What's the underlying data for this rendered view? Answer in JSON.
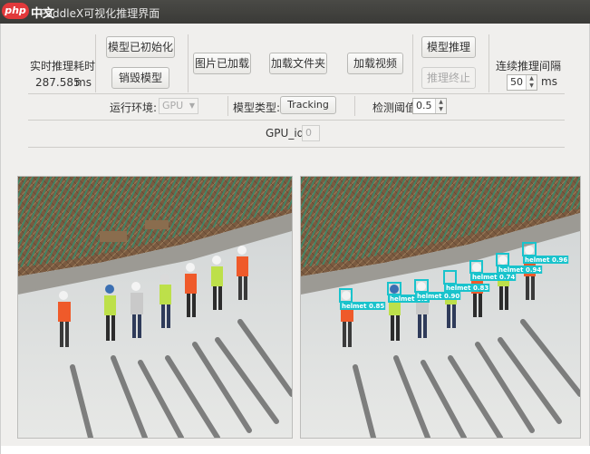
{
  "window": {
    "title": "PaddleX可视化推理界面",
    "watermark_php": "php",
    "watermark_cn": "中文网"
  },
  "controls": {
    "infer_time_label": "实时推理耗时",
    "infer_time_value": "287.585",
    "infer_time_unit": "ms",
    "init_model_btn": "模型已初始化",
    "destroy_model_btn": "销毁模型",
    "image_loaded_btn": "图片已加载",
    "load_folder_btn": "加载文件夹",
    "load_video_btn": "加载视频",
    "model_infer_btn": "模型推理",
    "stop_infer_btn": "推理终止",
    "interval_label": "连续推理间隔",
    "interval_value": "50",
    "interval_unit": "ms"
  },
  "settings": {
    "env_label": "运行环境:",
    "env_value": "GPU",
    "model_type_label": "模型类型:",
    "model_type_value": "Tracking",
    "threshold_label": "检测阈值",
    "threshold_value": "0.5",
    "gpu_id_label": "GPU_id",
    "gpu_id_value": "0"
  },
  "detections": {
    "class_label": "helmet",
    "box_color": "#19c3cc",
    "items": [
      {
        "score": "0.85"
      },
      {
        "score": "0.9"
      },
      {
        "score": "0.90"
      },
      {
        "score": "0.83"
      },
      {
        "score": "0.74"
      },
      {
        "score": "0.94"
      },
      {
        "score": "0.96"
      }
    ]
  },
  "colors": {
    "title_bar": "#3d3d3a",
    "window_bg": "#f0efed",
    "accent_red": "#e2393b",
    "helmet_box": "#19c3cc"
  }
}
